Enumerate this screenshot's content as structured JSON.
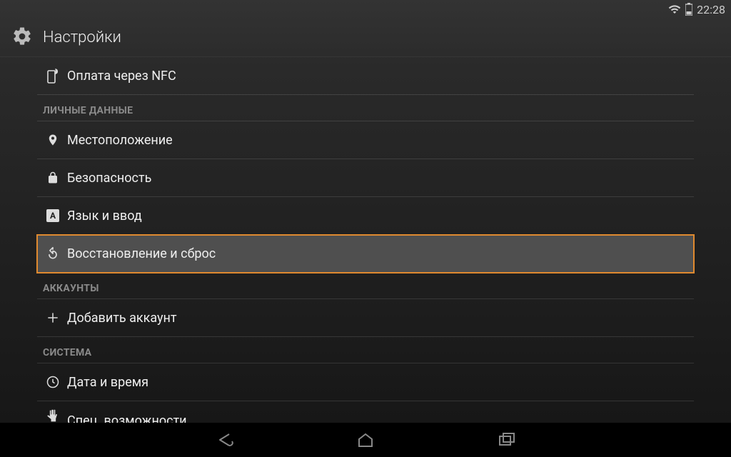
{
  "status": {
    "time": "22:28"
  },
  "header": {
    "title": "Настройки"
  },
  "sections": {
    "item_nfc": "Оплата через NFC",
    "personal_header": "ЛИЧНЫЕ ДАННЫЕ",
    "item_location": "Местоположение",
    "item_security": "Безопасность",
    "item_language": "Язык и ввод",
    "item_backup": "Восстановление и сброс",
    "accounts_header": "АККАУНТЫ",
    "item_add_account": "Добавить аккаунт",
    "system_header": "СИСТЕМА",
    "item_datetime": "Дата и время",
    "item_accessibility": "Спец. возможности"
  }
}
